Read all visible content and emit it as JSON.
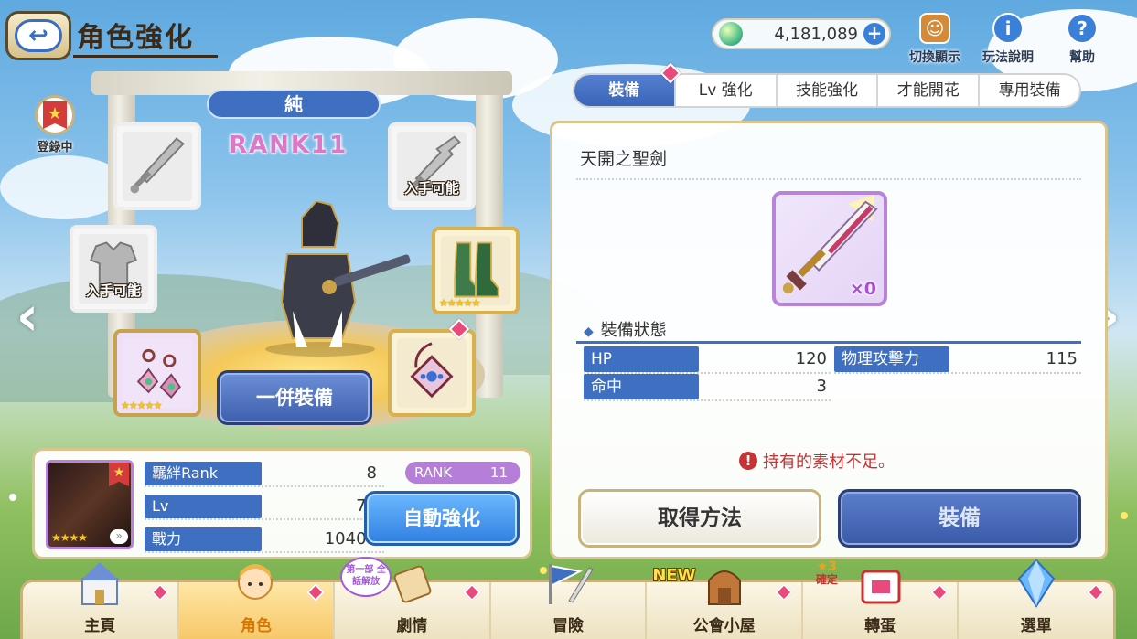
{
  "header": {
    "title": "角色強化",
    "back_label": "↩",
    "currency_amount": "4,181,089",
    "currency_plus": "+",
    "utils": [
      {
        "label": "切換顯示",
        "icon": "character-switch-icon"
      },
      {
        "label": "玩法說明",
        "icon": "info-icon"
      },
      {
        "label": "幫助",
        "icon": "help-icon"
      }
    ]
  },
  "character": {
    "registered_label": "登錄中",
    "name": "純",
    "rank_text": "RANK11",
    "equip_all_label": "一併裝備",
    "slots": [
      {
        "name": "sword-slot",
        "tag": "",
        "stars": ""
      },
      {
        "name": "broken-sword-slot",
        "tag": "入手可能",
        "stars": ""
      },
      {
        "name": "armor-slot",
        "tag": "入手可能",
        "stars": ""
      },
      {
        "name": "boots-slot",
        "tag": "",
        "stars": "★★★★★"
      },
      {
        "name": "earring-slot",
        "tag": "",
        "stars": "★★★★★"
      },
      {
        "name": "amulet-slot",
        "tag": "",
        "stars": ""
      }
    ]
  },
  "status": {
    "bond_label": "羈絆Rank",
    "bond_value": "8",
    "lv_label": "Lv",
    "lv_value": "77",
    "power_label": "戰力",
    "power_value": "10401",
    "rank_label": "RANK",
    "rank_value": "11",
    "portrait_stars": "★★★★",
    "auto_label": "自動強化"
  },
  "tabs": [
    "裝備",
    "Lv 強化",
    "技能強化",
    "才能開花",
    "專用裝備"
  ],
  "equipment": {
    "name": "天開之聖劍",
    "count": "×0",
    "section_title": "裝備狀態",
    "stats": [
      {
        "label": "HP",
        "value": "120"
      },
      {
        "label": "物理攻擊力",
        "value": "115"
      },
      {
        "label": "命中",
        "value": "3"
      }
    ],
    "warning": "持有的素材不足。",
    "get_label": "取得方法",
    "equip_label": "裝備"
  },
  "nav": {
    "items": [
      {
        "label": "主頁",
        "icon": "castle-icon"
      },
      {
        "label": "角色",
        "icon": "character-icon"
      },
      {
        "label": "劇情",
        "icon": "story-scroll-icon"
      },
      {
        "label": "冒險",
        "icon": "adventure-flag-icon"
      },
      {
        "label": "公會小屋",
        "icon": "guild-house-icon"
      },
      {
        "label": "轉蛋",
        "icon": "gacha-icon"
      },
      {
        "label": "選單",
        "icon": "menu-crystal-icon"
      }
    ],
    "story_badge": "第一部 全話解放",
    "new_badge": "NEW",
    "gacha_badge_top": "★3",
    "gacha_badge_bottom": "確定"
  },
  "colors": {
    "accent_blue": "#3f6fc1",
    "rank_pink": "#d979c7",
    "warning_red": "#c73232",
    "frame_gold": "#d9c48e"
  }
}
